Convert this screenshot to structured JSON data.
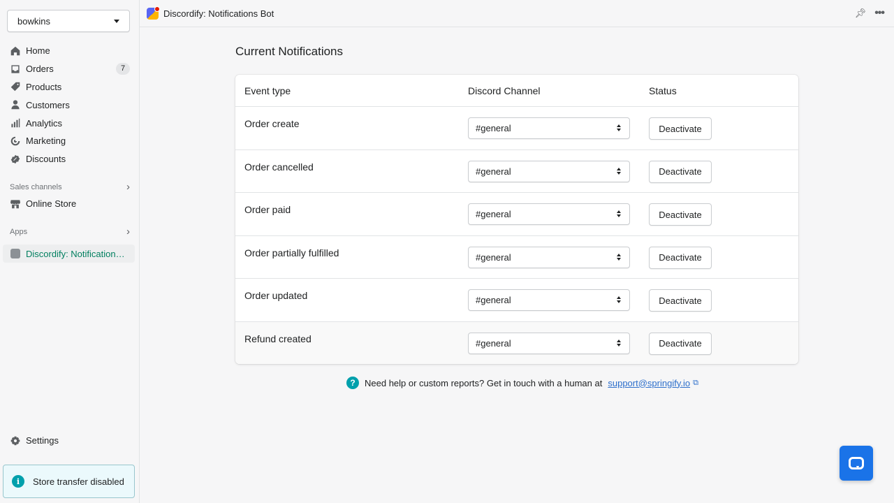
{
  "sidebar": {
    "store_name": "bowkins",
    "nav": [
      {
        "label": "Home",
        "icon": "home-icon"
      },
      {
        "label": "Orders",
        "icon": "inbox-icon",
        "badge": "7"
      },
      {
        "label": "Products",
        "icon": "tag-icon"
      },
      {
        "label": "Customers",
        "icon": "person-icon"
      },
      {
        "label": "Analytics",
        "icon": "bar-chart-icon"
      },
      {
        "label": "Marketing",
        "icon": "target-icon"
      },
      {
        "label": "Discounts",
        "icon": "discount-icon"
      }
    ],
    "sales_channels_title": "Sales channels",
    "online_store_label": "Online Store",
    "apps_title": "Apps",
    "active_app_label": "Discordify: Notification…",
    "settings_label": "Settings",
    "store_transfer_label": "Store transfer disabled"
  },
  "topbar": {
    "title": "Discordify: Notifications Bot"
  },
  "main": {
    "page_title": "Current Notifications",
    "table": {
      "headers": [
        "Event type",
        "Discord Channel",
        "Status"
      ],
      "rows": [
        {
          "event": "Order create",
          "channel": "#general",
          "action": "Deactivate"
        },
        {
          "event": "Order cancelled",
          "channel": "#general",
          "action": "Deactivate"
        },
        {
          "event": "Order paid",
          "channel": "#general",
          "action": "Deactivate"
        },
        {
          "event": "Order partially fulfilled",
          "channel": "#general",
          "action": "Deactivate"
        },
        {
          "event": "Order updated",
          "channel": "#general",
          "action": "Deactivate"
        },
        {
          "event": "Refund created",
          "channel": "#general",
          "action": "Deactivate"
        }
      ]
    },
    "help": {
      "text": "Need help or custom reports? Get in touch with a human at",
      "link": "support@springify.io"
    }
  },
  "colors": {
    "accent": "#007f5f",
    "info": "#00a0ac",
    "link": "#2c6ecb",
    "chat": "#1a73e8"
  }
}
